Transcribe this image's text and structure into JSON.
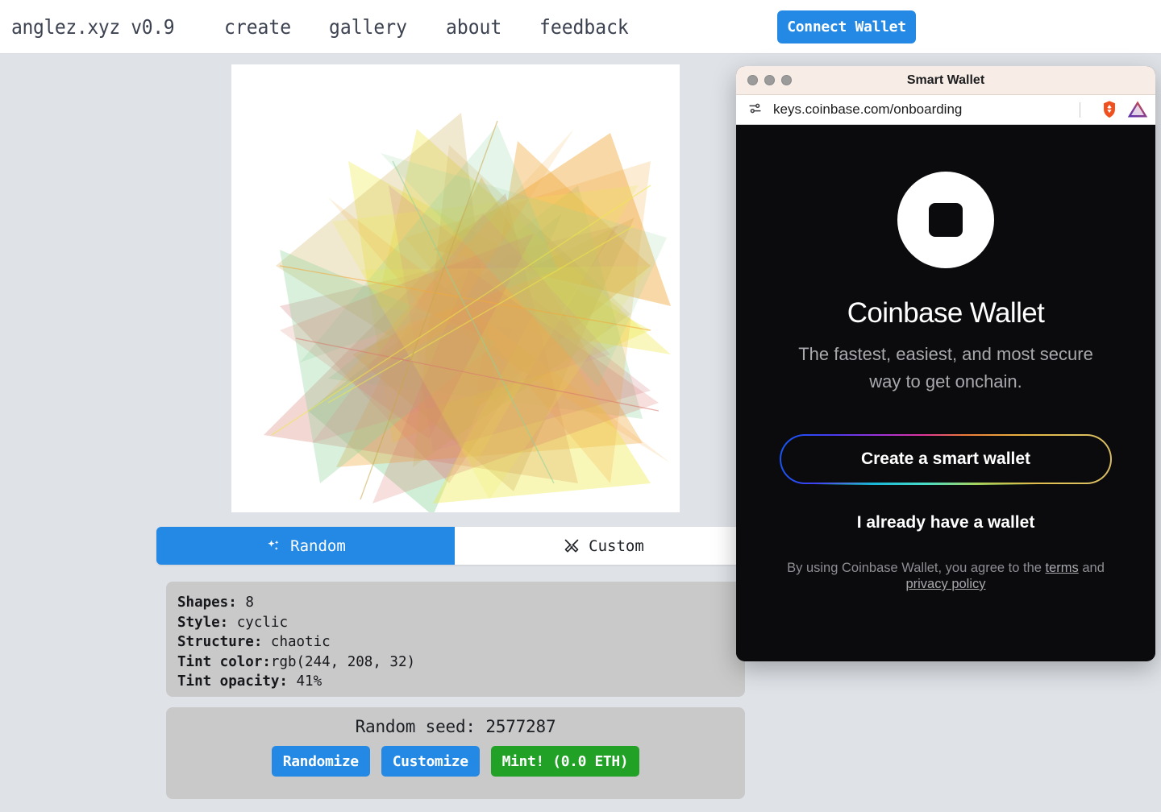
{
  "nav": {
    "brand": "anglez.xyz v0.9",
    "links": [
      {
        "label": "create",
        "name": "nav-link-create"
      },
      {
        "label": "gallery",
        "name": "nav-link-gallery"
      },
      {
        "label": "about",
        "name": "nav-link-about"
      },
      {
        "label": "feedback",
        "name": "nav-link-feedback"
      }
    ],
    "connect_wallet": "Connect Wallet",
    "accent_color": "#2489e4"
  },
  "artwork": {
    "background": "#ffffff",
    "palette": [
      "#f0a93c",
      "#eeea4a",
      "#8fd39a",
      "#d98f92",
      "#d87b6e",
      "#c8a84a"
    ]
  },
  "tabs": [
    {
      "label": "Random",
      "icon": "sparkles-icon",
      "active": true
    },
    {
      "label": "Custom",
      "icon": "tools-icon",
      "active": false
    }
  ],
  "params": [
    {
      "label": "Shapes:",
      "value": "8"
    },
    {
      "label": "Style:",
      "value": "cyclic"
    },
    {
      "label": "Structure:",
      "value": "chaotic"
    },
    {
      "label": "Tint color:",
      "value": "rgb(244, 208, 32)"
    },
    {
      "label": "Tint opacity:",
      "value": "41%"
    }
  ],
  "seed": {
    "label": "Random seed: 2577287",
    "buttons": [
      {
        "label": "Randomize",
        "color": "#2489e4"
      },
      {
        "label": "Customize",
        "color": "#2489e4"
      },
      {
        "label": "Mint! (0.0 ETH)",
        "color": "#22a127"
      }
    ]
  },
  "popup": {
    "window_title": "Smart Wallet",
    "url": "keys.coinbase.com/onboarding",
    "extensions": [
      "brave-lion-icon",
      "bat-triangle-icon"
    ],
    "wallet": {
      "logo": "coinbase-logo",
      "title": "Coinbase Wallet",
      "subtitle": "The fastest, easiest, and most secure way to get onchain.",
      "primary_button": "Create a smart wallet",
      "secondary_button": "I already have a wallet",
      "legal_prefix": "By using Coinbase Wallet, you agree to the ",
      "legal_terms": "terms",
      "legal_middle": " and ",
      "legal_privacy": "privacy policy"
    }
  }
}
